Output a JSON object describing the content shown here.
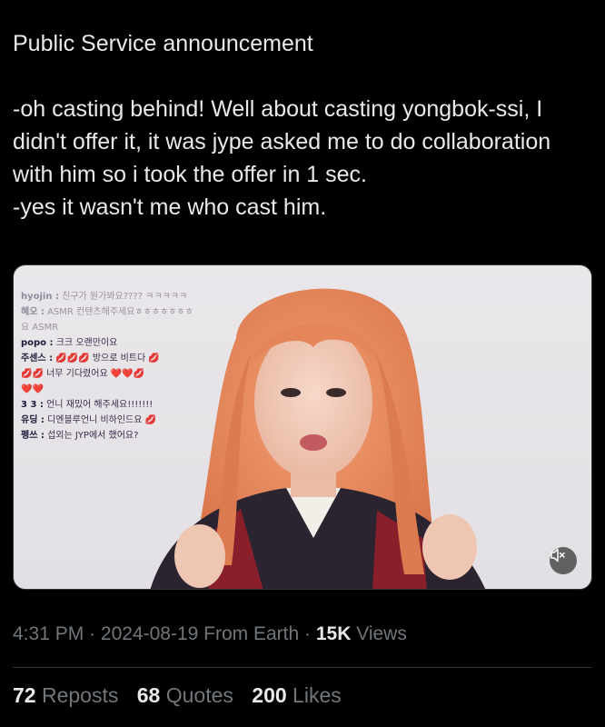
{
  "tweet": {
    "lines": [
      "Public Service announcement",
      "-oh casting behind! Well about casting yongbok-ssi, I didn't offer it, it was jype asked me to do collaboration with him so i took the offer in 1 sec.",
      "-yes it wasn't me who cast him."
    ]
  },
  "media": {
    "chat": [
      {
        "user": "hyojin :",
        "text": "친구가 뭔가봐요???? ㅋㅋㅋㅋㅋ",
        "faded": true
      },
      {
        "user": "혜오 :",
        "text": "ASMR 컨텐츠해주세요ㅎㅎㅎㅎㅎㅎㅎ",
        "faded": true
      },
      {
        "user": "",
        "text": "요 ASMR",
        "faded": true
      },
      {
        "user": "popo :",
        "text": "크크 오랜만이요",
        "faded": false
      },
      {
        "user": "주센스 :",
        "text": "💋💋💋 방으로 비트다 💋",
        "faded": false
      },
      {
        "user": "",
        "text": "💋💋 너무 기다렸어요 ❤️❤️💋",
        "faded": false
      },
      {
        "user": "",
        "text": "❤️❤️",
        "faded": false
      },
      {
        "user": "3 3 :",
        "text": "언니 재밌어 해주세요!!!!!!!",
        "faded": false
      },
      {
        "user": "유딩 :",
        "text": "디엔블루언니 비하인드요 💋",
        "faded": false
      },
      {
        "user": "펭쓰 :",
        "text": "섭외는 JYP에서 했어요?",
        "faded": false
      }
    ],
    "mute_icon": "speaker-muted-icon"
  },
  "meta": {
    "time": "4:31 PM",
    "sep1": " · ",
    "date": "2024-08-19",
    "source": " From Earth",
    "sep2": " · ",
    "views_count": "15K",
    "views_label": " Views"
  },
  "stats": {
    "reposts_count": "72",
    "reposts_label": " Reposts",
    "quotes_count": "68",
    "quotes_label": " Quotes",
    "likes_count": "200",
    "likes_label": " Likes"
  },
  "colors": {
    "background": "#000000",
    "text": "#e7e9ea",
    "secondary": "#71767b",
    "hair": "#e98a5c"
  }
}
